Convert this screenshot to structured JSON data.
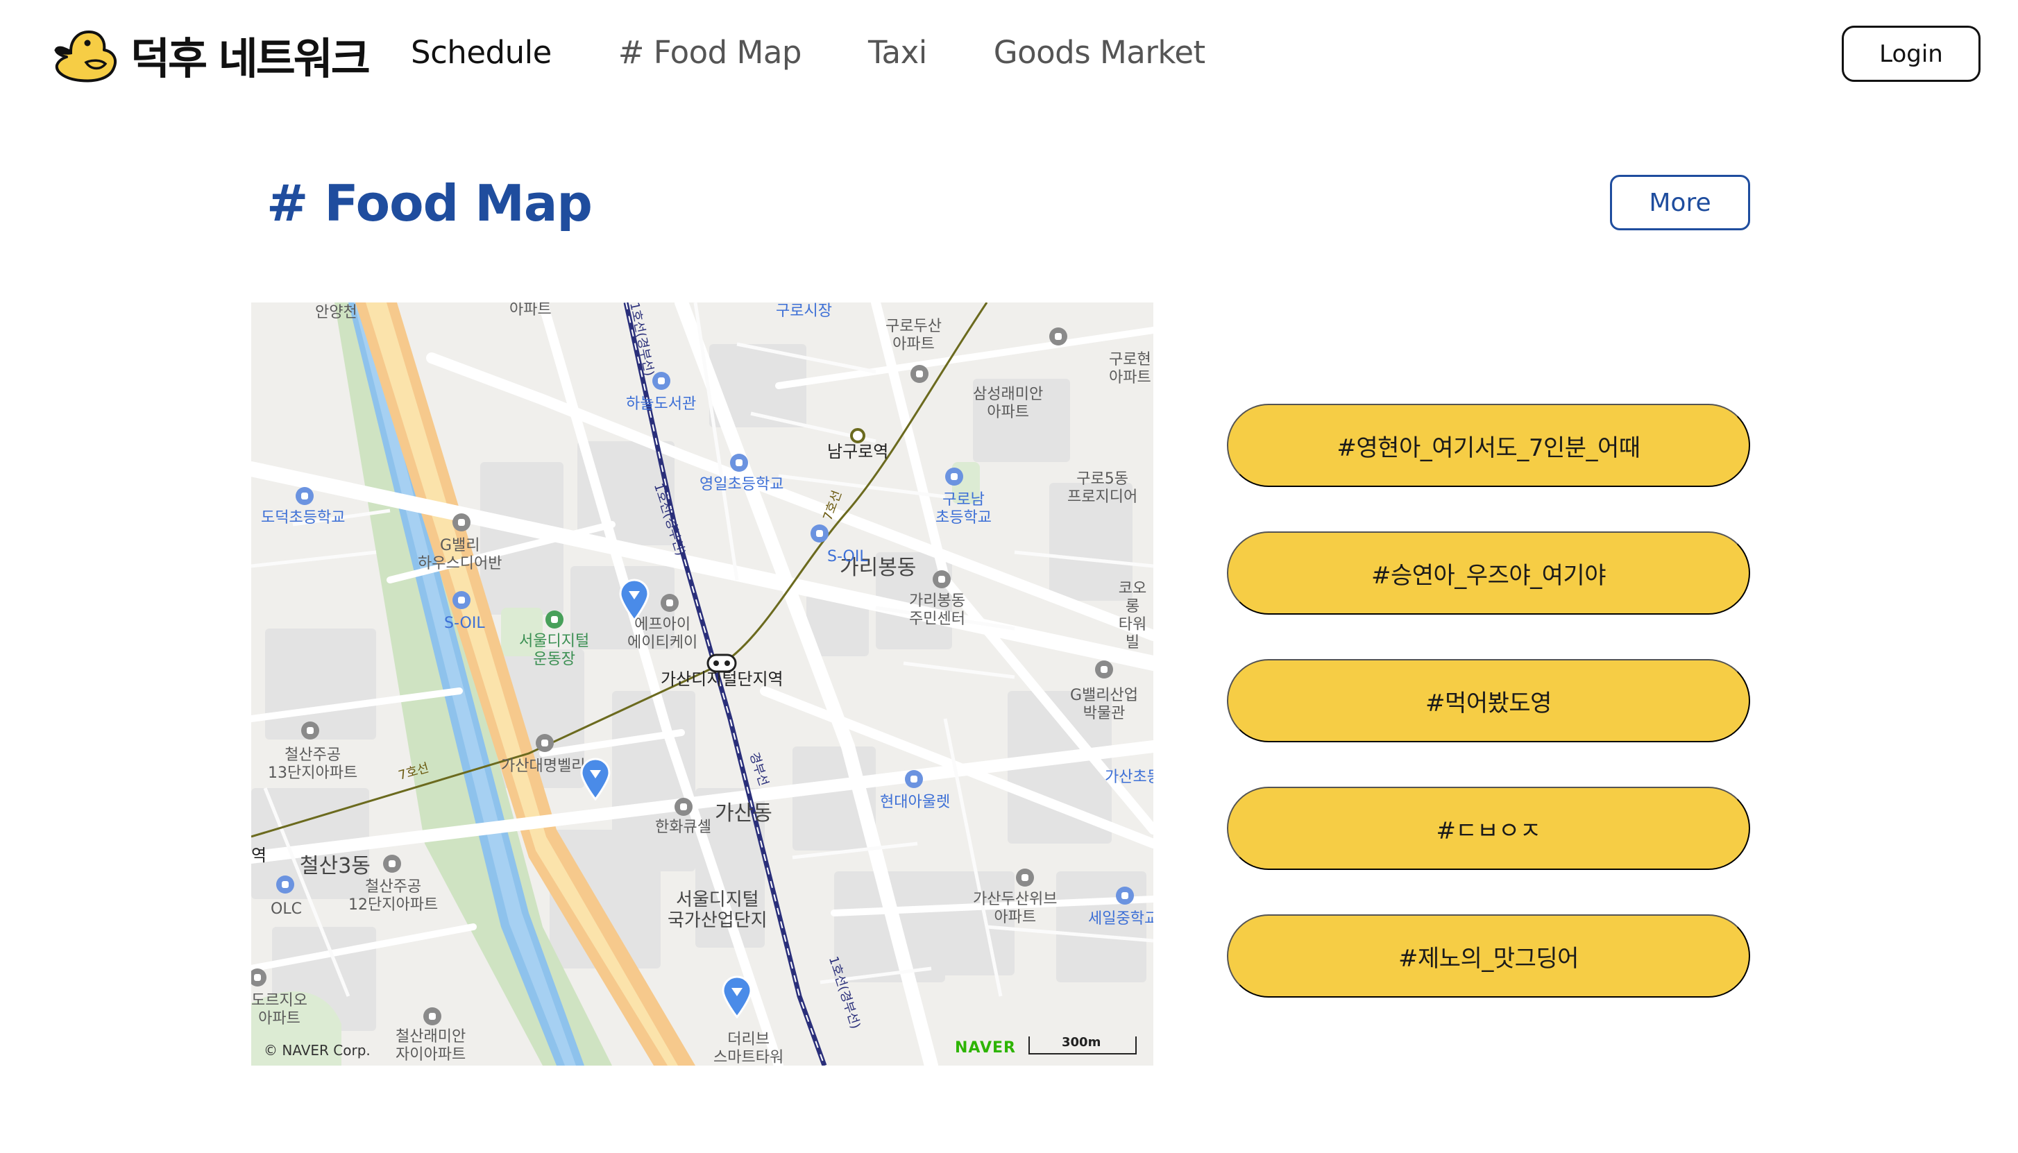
{
  "brand": {
    "name": "덕후 네트워크",
    "logo_icon": "duck-icon"
  },
  "nav": {
    "items": [
      {
        "label": "Schedule",
        "active": true
      },
      {
        "label": "# Food Map",
        "active": false
      },
      {
        "label": "Taxi",
        "active": false
      },
      {
        "label": "Goods Market",
        "active": false
      }
    ]
  },
  "header": {
    "login_label": "Login"
  },
  "section": {
    "title": "# Food Map",
    "more_label": "More"
  },
  "map": {
    "labels": [
      "안양천",
      "아파트",
      "구로시장",
      "구로두산\n아파트",
      "구로현\n아파트",
      "하늘도서관",
      "삼성래미안\n아파트",
      "남구로역",
      "영일초등학교",
      "구로남\n초등학교",
      "구로5동\n프로지디어",
      "도덕초등학교",
      "G밸리\n하우스디어반",
      "S-OIL",
      "가리봉동",
      "가리봉동\n주민센터",
      "코오롱\n타워빌",
      "S-OIL",
      "서울디지털\n운동장",
      "에프아이\n에이티케이",
      "가산디지털단지역",
      "G밸리산업\n박물관",
      "철산주공\n13단지아파트",
      "가산대명벨리",
      "가산초등",
      "현대아울렛",
      "한화큐셀",
      "가산동",
      "철산3동",
      "철산주공\n12단지아파트",
      "OLC",
      "서울디지털\n국가산업단지",
      "가산두산위브\n아파트",
      "세일중학교",
      "도르지오\n아파트",
      "철산래미안\n자이아파트",
      "더리브\n스마트타워",
      "1호선(경부선)",
      "1호선(경부선)",
      "7호선",
      "7호선",
      "경부선",
      "1호선(경부선)",
      "역"
    ],
    "copyright": "© NAVER Corp.",
    "provider": "NAVER",
    "scale": "300m"
  },
  "tags": [
    "#영현아_여기서도_7인분_어때",
    "#승연아_우즈야_여기야",
    "#먹어봤도영",
    "#ㄷㅂㅇㅈ",
    "#제노의_맛그딩어"
  ],
  "colors": {
    "title_blue": "#1f4d9e",
    "tag_yellow": "#f6cd45",
    "duck_yellow": "#f6cd45",
    "pin_blue": "#4a8be8"
  }
}
